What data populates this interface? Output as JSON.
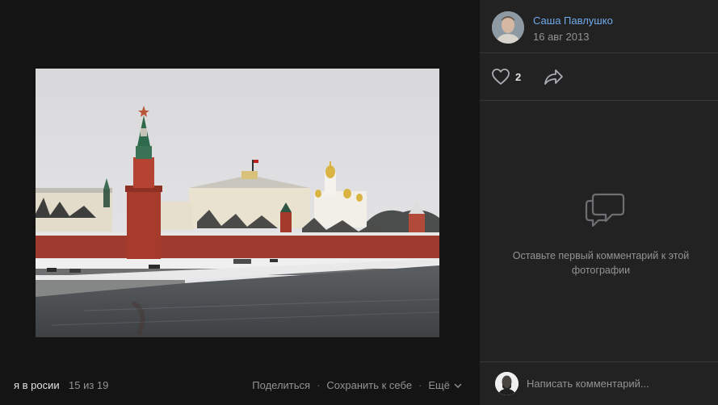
{
  "photo": {
    "alt": ""
  },
  "footer": {
    "album_name": "я в росии",
    "counter": "15 из 19",
    "share_label": "Поделиться",
    "save_label": "Сохранить к себе",
    "more_label": "Ещё",
    "separator": "·"
  },
  "author": {
    "name": "Саша Павлушко",
    "date": "16 авг 2013"
  },
  "reactions": {
    "likes": "2"
  },
  "comments": {
    "empty_text": "Оставьте первый комментарий к этой фотографии",
    "input_placeholder": "Написать комментарий..."
  },
  "colors": {
    "background": "#141414",
    "sidebar": "#222222",
    "link": "#71aaeb",
    "muted": "#939393",
    "text": "#e1e3e6"
  }
}
